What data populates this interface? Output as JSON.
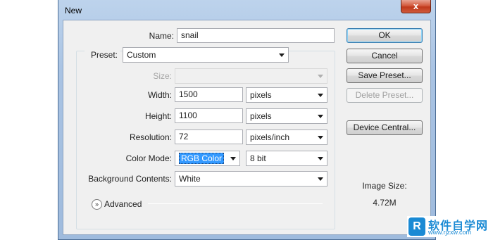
{
  "window": {
    "title": "New",
    "close_glyph": "x"
  },
  "form": {
    "name_label": "Name:",
    "name_value": "snail",
    "preset_label": "Preset:",
    "preset_value": "Custom",
    "size_label": "Size:",
    "size_value": "",
    "width_label": "Width:",
    "width_value": "1500",
    "width_unit": "pixels",
    "height_label": "Height:",
    "height_value": "1100",
    "height_unit": "pixels",
    "resolution_label": "Resolution:",
    "resolution_value": "72",
    "resolution_unit": "pixels/inch",
    "colormode_label": "Color Mode:",
    "colormode_value": "RGB Color",
    "bitdepth_value": "8 bit",
    "background_label": "Background Contents:",
    "background_value": "White",
    "advanced_label": "Advanced"
  },
  "buttons": {
    "ok": "OK",
    "cancel": "Cancel",
    "save_preset": "Save Preset...",
    "delete_preset": "Delete Preset...",
    "device_central": "Device Central..."
  },
  "info": {
    "image_size_label": "Image Size:",
    "image_size_value": "4.72M"
  },
  "watermark": {
    "logo": "R",
    "text": "软件自学网",
    "url": "www.rjzxw.com"
  },
  "colors": {
    "selection": "#3399ff",
    "frame": "#a9c3e3",
    "watermark": "#1a8ad4"
  }
}
